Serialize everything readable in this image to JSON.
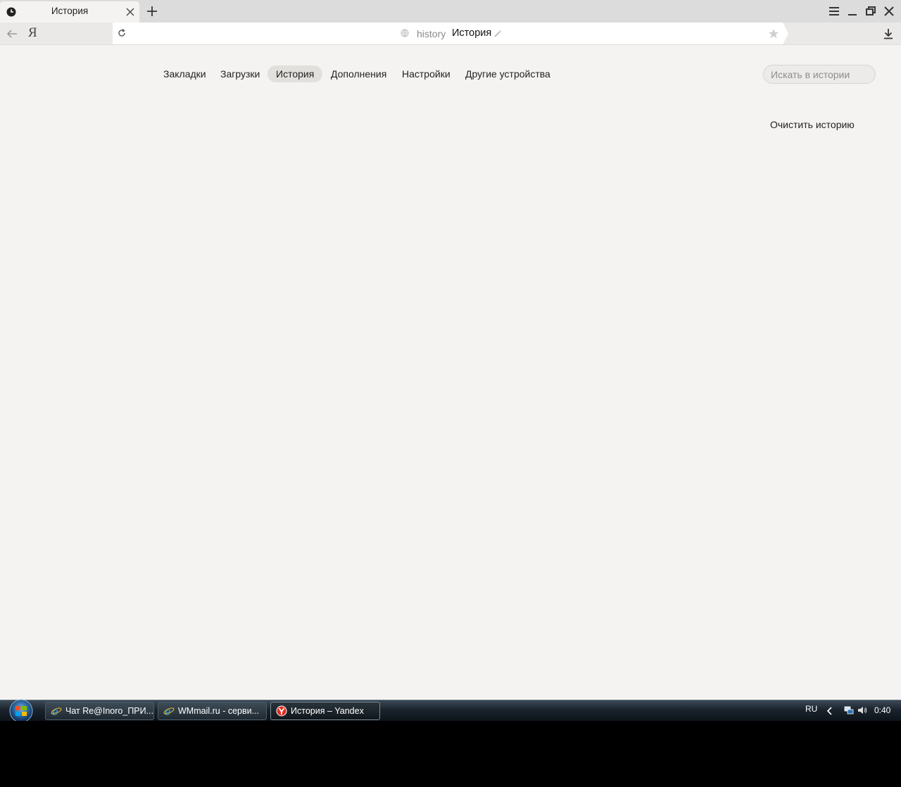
{
  "browser": {
    "tab": {
      "title": "История"
    },
    "address": {
      "scheme": "history",
      "title": "История"
    }
  },
  "page": {
    "nav": [
      {
        "label": "Закладки",
        "active": false
      },
      {
        "label": "Загрузки",
        "active": false
      },
      {
        "label": "История",
        "active": true
      },
      {
        "label": "Дополнения",
        "active": false
      },
      {
        "label": "Настройки",
        "active": false
      },
      {
        "label": "Другие устройства",
        "active": false
      }
    ],
    "search": {
      "placeholder": "Искать в истории"
    },
    "clear_history": "Очистить историю"
  },
  "taskbar": {
    "tasks": [
      {
        "label": "Чат Re@Inoro_ПРИ...",
        "icon": "ie-icon",
        "active": false
      },
      {
        "label": "WMmail.ru - серви...",
        "icon": "ie-icon",
        "active": false
      },
      {
        "label": "История – Yandex",
        "icon": "yandex-icon",
        "active": true
      }
    ],
    "language": "RU",
    "clock": "0:40"
  },
  "colors": {
    "page_bg": "#f4f3f1",
    "active_pill": "#e2e0dd",
    "tabstrip_bg": "#dcdcdc"
  }
}
